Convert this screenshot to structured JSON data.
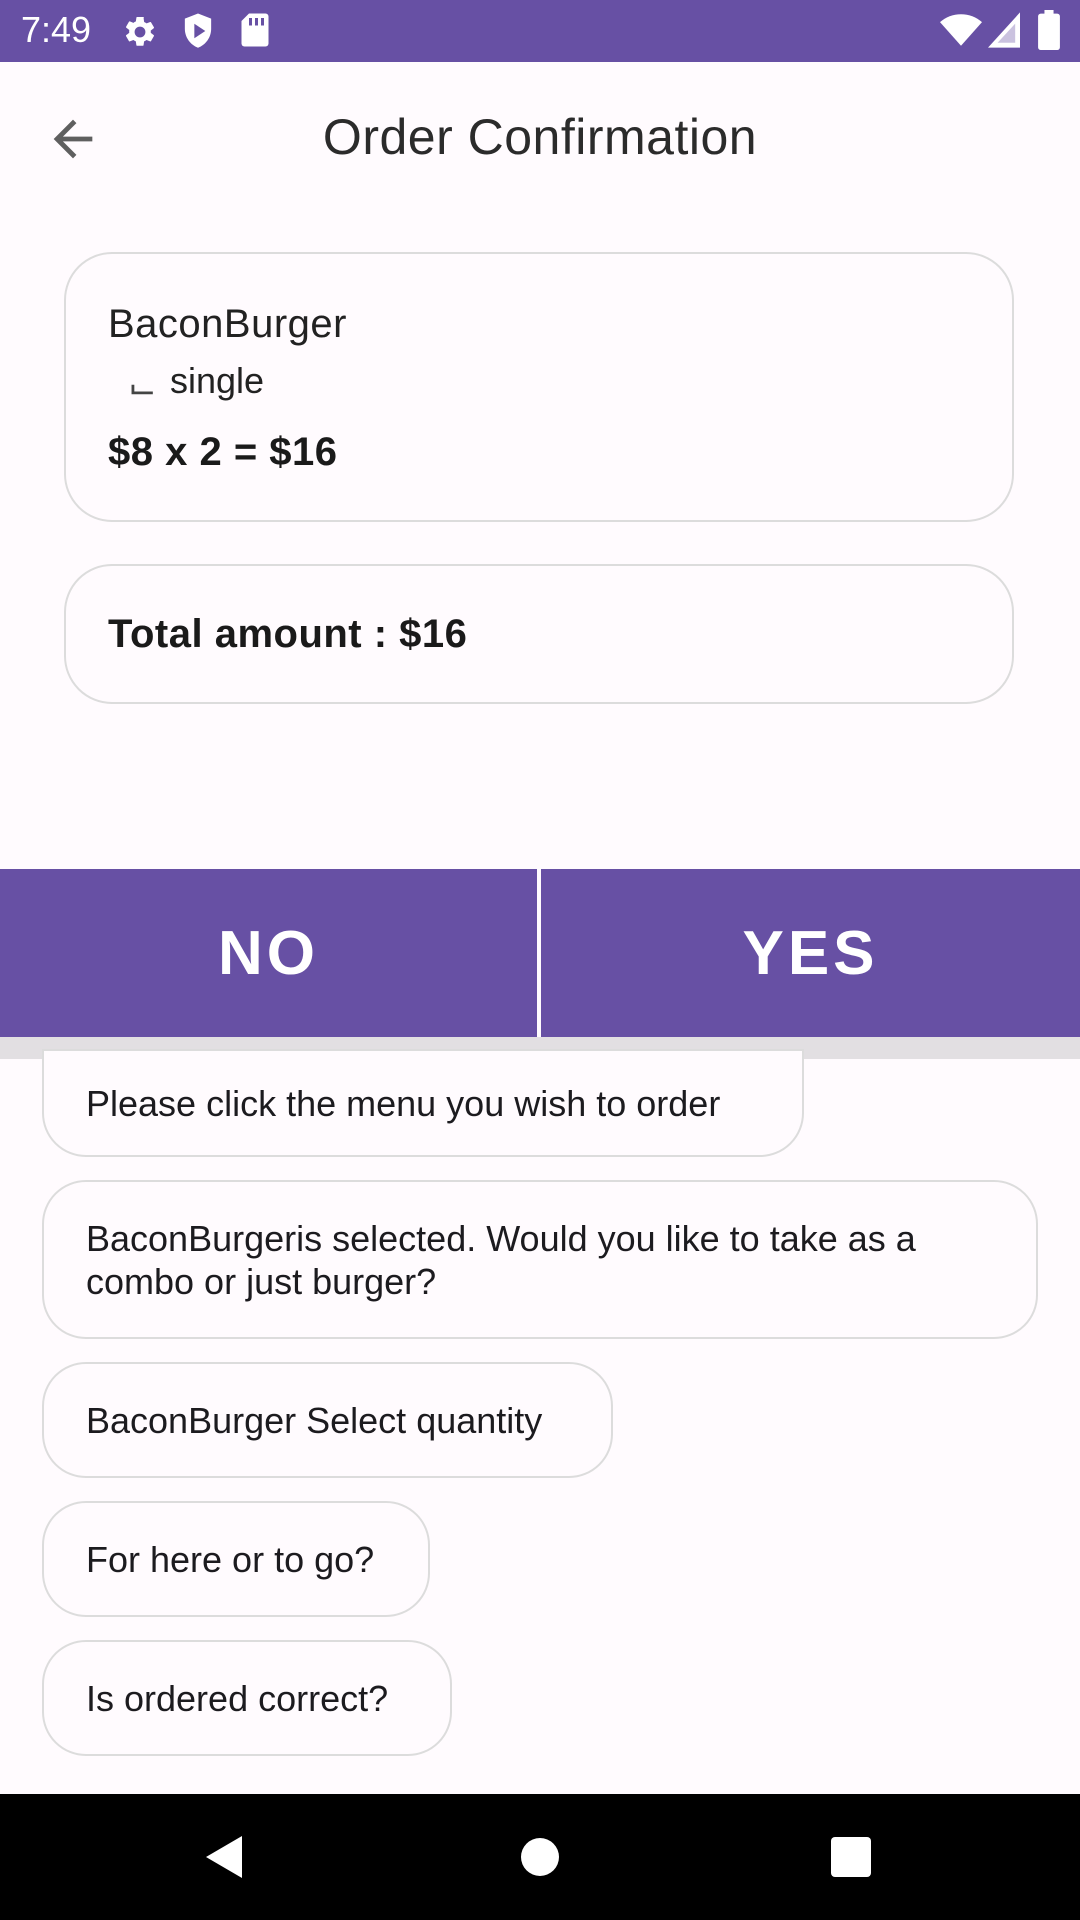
{
  "status_bar": {
    "time": "7:49",
    "icons": [
      "settings-gear-icon",
      "play-protect-shield-icon",
      "sd-card-icon",
      "wifi-icon",
      "cell-signal-icon",
      "battery-icon"
    ],
    "background_color": "#6750a4"
  },
  "header": {
    "title": "Order Confirmation",
    "back_icon": "arrow-back-icon"
  },
  "order_item": {
    "name": "BaconBurger",
    "option_glyph": "⌙",
    "option": "single",
    "price_line": "$8 x 2 = $16"
  },
  "total": {
    "text": "Total amount : $16"
  },
  "actions": {
    "no_label": "NO",
    "yes_label": "YES",
    "color": "#6750a4"
  },
  "chat": {
    "messages": [
      "Please click the menu you wish to order",
      "BaconBurgeris selected. Would you like to take as a combo or just burger?",
      "BaconBurger Select quantity",
      "For here or to go?",
      "Is ordered correct?"
    ]
  },
  "nav_bar": {
    "icons": [
      "back-triangle-icon",
      "home-circle-icon",
      "recents-square-icon"
    ]
  }
}
